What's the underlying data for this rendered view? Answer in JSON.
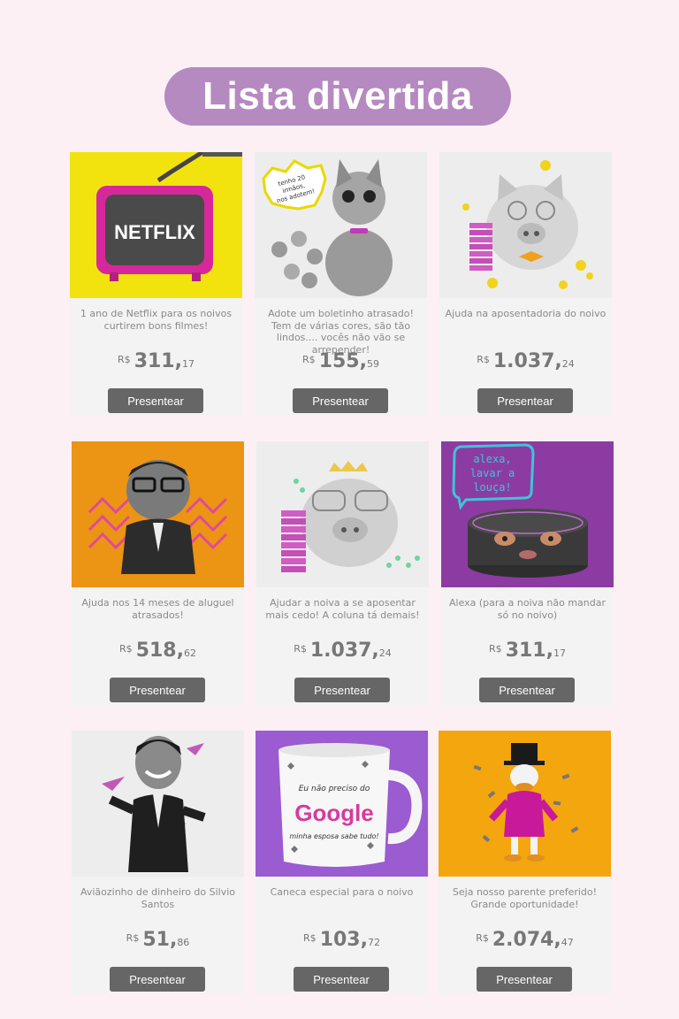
{
  "page": {
    "title": "Lista divertida"
  },
  "colors": {
    "title_bg": "#b58ac0",
    "page_bg": "#fcf0f5",
    "button_bg": "#666666"
  },
  "products": [
    {
      "image": "netflix-tv-image",
      "image_text": "NETFLIX",
      "description": "1 ano de Netflix para os noivos curtirem bons filmes!",
      "currency": "R$",
      "price_int": "311,",
      "price_cents": "17",
      "button": "Presentear"
    },
    {
      "image": "kittens-image",
      "image_text": "tenho 20 irmãos, nos adotem!",
      "description": "Adote um boletinho atrasado! Tem de várias cores, são tão lindos.... vocês não vão se arrepender!",
      "currency": "R$",
      "price_int": "155,",
      "price_cents": "59",
      "button": "Presentear"
    },
    {
      "image": "piggy-bank-bowtie-image",
      "description": "Ajuda na aposentadoria do noivo",
      "currency": "R$",
      "price_int": "1.037,",
      "price_cents": "24",
      "button": "Presentear"
    },
    {
      "image": "man-in-suit-image",
      "description": "Ajuda nos 14 meses de aluguel atrasados!",
      "currency": "R$",
      "price_int": "518,",
      "price_cents": "62",
      "button": "Presentear"
    },
    {
      "image": "piggy-bank-tiara-image",
      "description": "Ajudar a noiva a se aposentar mais cedo! A coluna tá demais!",
      "currency": "R$",
      "price_int": "1.037,",
      "price_cents": "24",
      "button": "Presentear"
    },
    {
      "image": "alexa-speaker-image",
      "image_text": "alexa, lavar a louça!",
      "description": "Alexa (para a noiva não mandar só no noivo)",
      "currency": "R$",
      "price_int": "311,",
      "price_cents": "17",
      "button": "Presentear"
    },
    {
      "image": "silvio-santos-image",
      "description": "Aviãozinho de dinheiro do Silvio Santos",
      "currency": "R$",
      "price_int": "51,",
      "price_cents": "86",
      "button": "Presentear"
    },
    {
      "image": "google-mug-image",
      "image_text": "Eu não preciso do Google minha esposa sabe tudo!",
      "description": "Caneca especial para o noivo",
      "currency": "R$",
      "price_int": "103,",
      "price_cents": "72",
      "button": "Presentear"
    },
    {
      "image": "scrooge-mcduck-image",
      "description": "Seja nosso parente preferido! Grande oportunidade!",
      "currency": "R$",
      "price_int": "2.074,",
      "price_cents": "47",
      "button": "Presentear"
    }
  ]
}
